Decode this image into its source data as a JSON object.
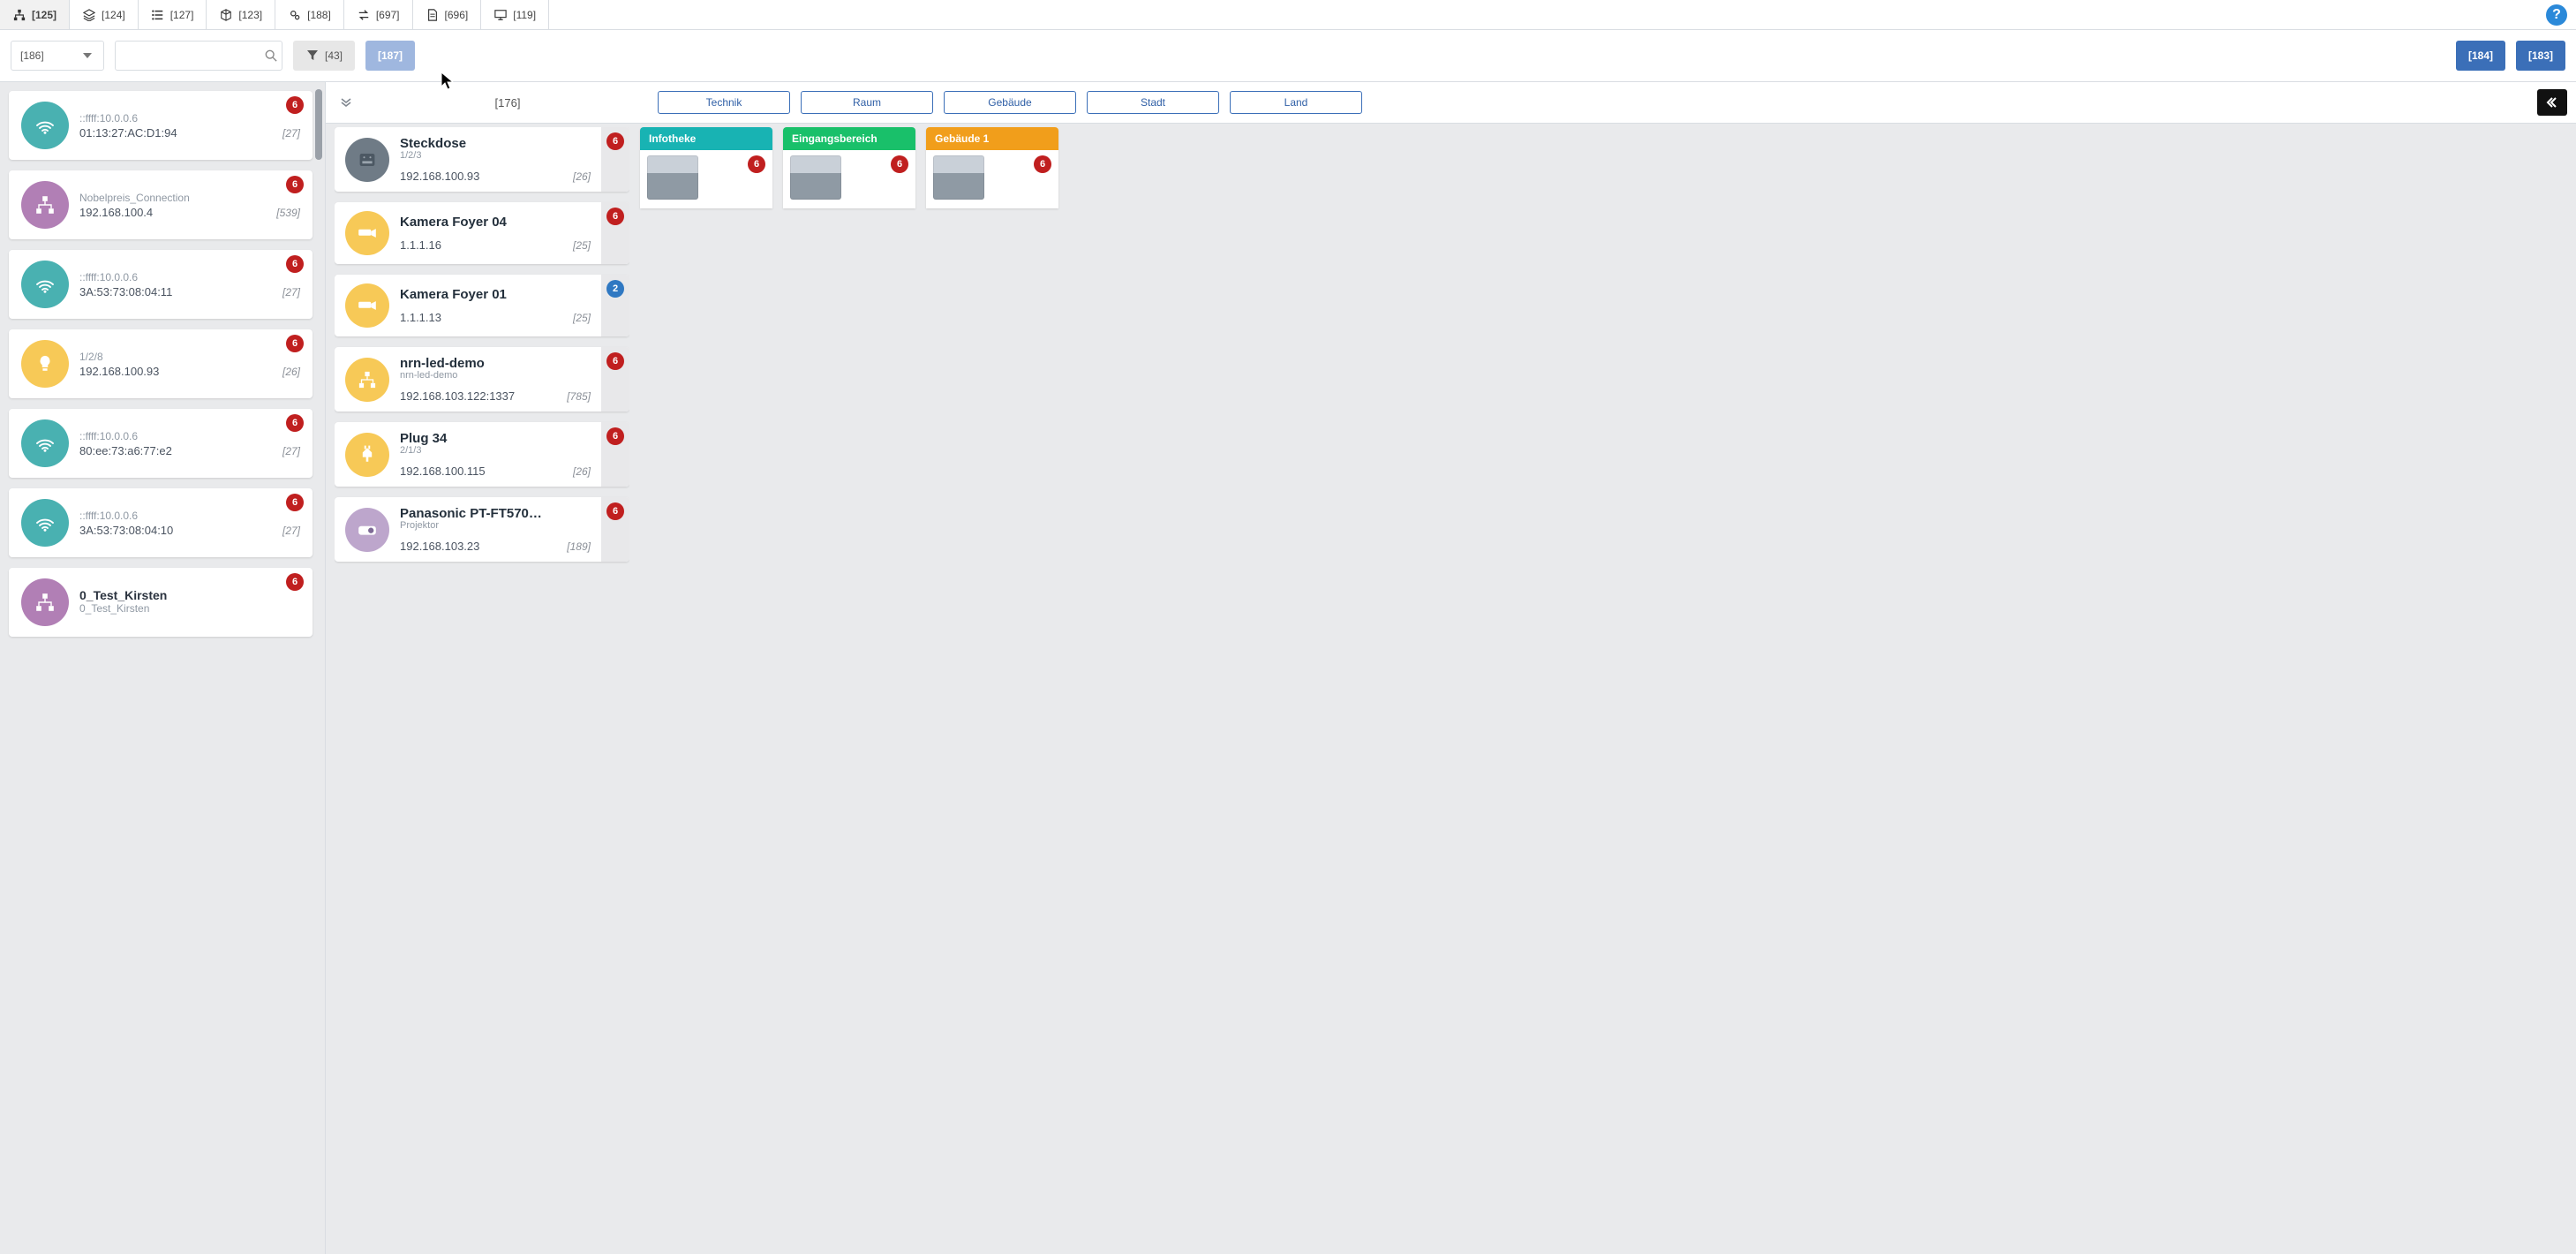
{
  "tabs": [
    {
      "icon": "hierarchy",
      "label": "[125]",
      "active": true
    },
    {
      "icon": "layers",
      "label": "[124]"
    },
    {
      "icon": "list",
      "label": "[127]"
    },
    {
      "icon": "cube",
      "label": "[123]"
    },
    {
      "icon": "gears",
      "label": "[188]"
    },
    {
      "icon": "transfer",
      "label": "[697]"
    },
    {
      "icon": "doc",
      "label": "[696]"
    },
    {
      "icon": "monitor",
      "label": "[119]"
    }
  ],
  "toolbar": {
    "select_label": "[186]",
    "search_placeholder": "",
    "filter_label": "[43]",
    "action_label": "[187]",
    "btn_right_1": "[184]",
    "btn_right_2": "[183]"
  },
  "left_items": [
    {
      "avatar": "wifi",
      "line1": "::ffff:10.0.0.6",
      "addr": "01:13:27:AC:D1:94",
      "count": "[27]",
      "badge": "6"
    },
    {
      "avatar": "net",
      "line1": "Nobelpreis_Connection",
      "addr": "192.168.100.4",
      "count": "[539]",
      "badge": "6"
    },
    {
      "avatar": "wifi",
      "line1": "::ffff:10.0.0.6",
      "addr": "3A:53:73:08:04:11",
      "count": "[27]",
      "badge": "6"
    },
    {
      "avatar": "bulb",
      "line1": "1/2/8",
      "addr": "192.168.100.93",
      "count": "[26]",
      "badge": "6"
    },
    {
      "avatar": "wifi",
      "line1": "::ffff:10.0.0.6",
      "addr": "80:ee:73:a6:77:e2",
      "count": "[27]",
      "badge": "6"
    },
    {
      "avatar": "wifi",
      "line1": "::ffff:10.0.0.6",
      "addr": "3A:53:73:08:04:10",
      "count": "[27]",
      "badge": "6"
    },
    {
      "avatar": "net",
      "title": "0_Test_Kirsten",
      "line1": "0_Test_Kirsten",
      "addr": "",
      "count": "",
      "badge": "6"
    }
  ],
  "right_header": {
    "title": "[176]",
    "pills": [
      "Technik",
      "Raum",
      "Gebäude",
      "Stadt",
      "Land"
    ]
  },
  "devices": [
    {
      "icon": "steck",
      "title": "Steckdose",
      "sub": "1/2/3",
      "ip": "192.168.100.93",
      "count": "[26]",
      "badge": "6",
      "badge_color": "red"
    },
    {
      "icon": "cam",
      "title": "Kamera Foyer 04",
      "sub": "",
      "ip": "1.1.1.16",
      "count": "[25]",
      "badge": "6",
      "badge_color": "red"
    },
    {
      "icon": "cam",
      "title": "Kamera Foyer 01",
      "sub": "",
      "ip": "1.1.1.13",
      "count": "[25]",
      "badge": "2",
      "badge_color": "blue"
    },
    {
      "icon": "net2",
      "title": "nrn-led-demo",
      "sub": "nrn-led-demo",
      "ip": "192.168.103.122:1337",
      "count": "[785]",
      "badge": "6",
      "badge_color": "red"
    },
    {
      "icon": "plug2",
      "title": "Plug 34",
      "sub": "2/1/3",
      "ip": "192.168.100.115",
      "count": "[26]",
      "badge": "6",
      "badge_color": "red"
    },
    {
      "icon": "proj",
      "title": "Panasonic PT-FT570…",
      "sub": "Projektor",
      "ip": "192.168.103.23",
      "count": "[189]",
      "badge": "6",
      "badge_color": "red"
    }
  ],
  "locations": [
    {
      "label": "Infotheke",
      "color": "teal",
      "badge": "6"
    },
    {
      "label": "Eingangsbereich",
      "color": "green",
      "badge": "6"
    },
    {
      "label": "Gebäude 1",
      "color": "orange",
      "badge": "6"
    }
  ]
}
